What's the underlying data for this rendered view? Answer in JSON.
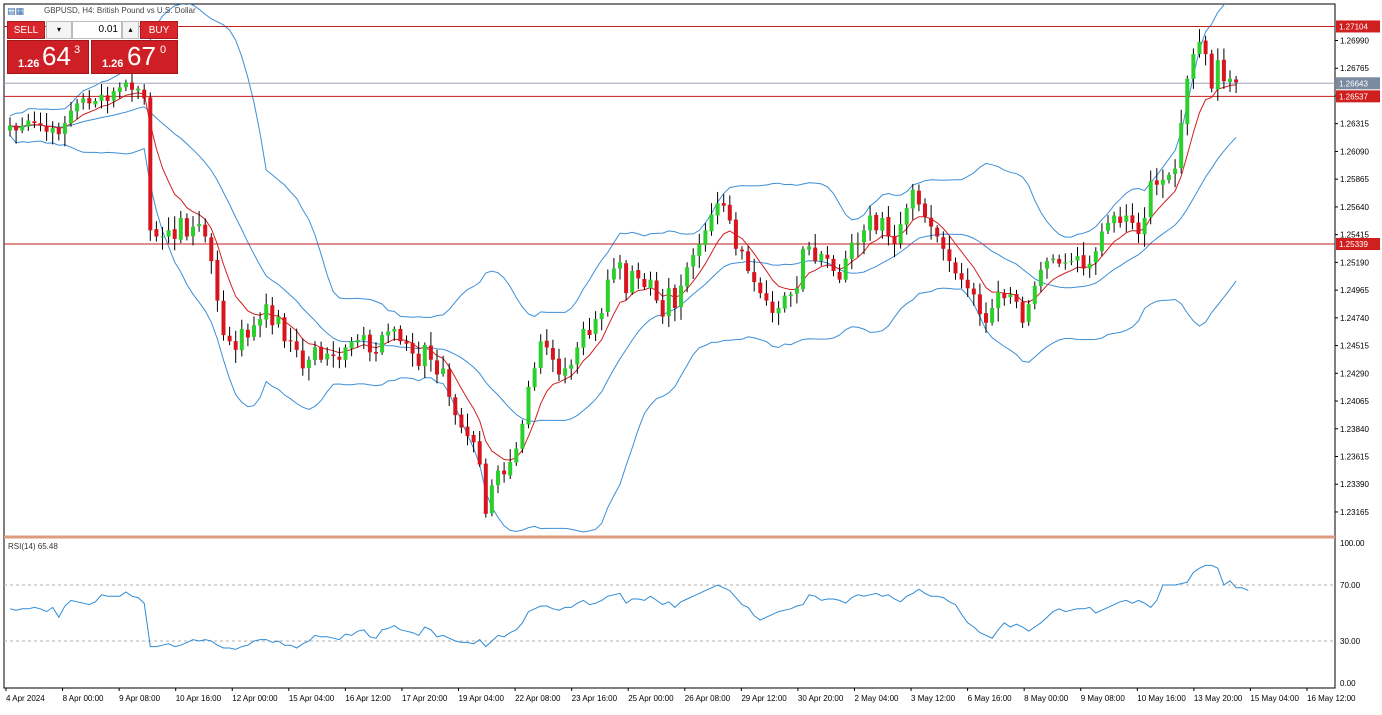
{
  "window": {
    "title": "GBPUSD, H4:  British Pound vs U.S. Dollar",
    "icon": "chart-window-icon"
  },
  "trade_panel": {
    "sell_label": "SELL",
    "buy_label": "BUY",
    "lot": "0.01",
    "bid": {
      "prefix": "1.26",
      "big": "64",
      "small": "3"
    },
    "ask": {
      "prefix": "1.26",
      "big": "67",
      "small": "0"
    },
    "colors": {
      "button": "#d8262c"
    }
  },
  "rsi": {
    "label": "RSI(14) 65.48",
    "levels": [
      "100.00",
      "70.00",
      "30.00",
      "0.00"
    ]
  },
  "price_tags": [
    {
      "value": "1.27104",
      "kind": "line",
      "color": "#d01f1f"
    },
    {
      "value": "1.26643",
      "kind": "current",
      "color": "#7a8aa0"
    },
    {
      "value": "1.26537",
      "kind": "line",
      "color": "#d01f1f"
    },
    {
      "value": "1.25339",
      "kind": "line",
      "color": "#d01f1f"
    }
  ],
  "chart_data": {
    "type": "candlestick",
    "symbol": "GBPUSD",
    "timeframe": "H4",
    "ylim": [
      1.2297,
      1.2727
    ],
    "y_ticks": [
      "1.26990",
      "1.26765",
      "1.26540",
      "1.26315",
      "1.26090",
      "1.25865",
      "1.25640",
      "1.25415",
      "1.25190",
      "1.24965",
      "1.24740",
      "1.24515",
      "1.24290",
      "1.24065",
      "1.23840",
      "1.23615",
      "1.23390",
      "1.23165"
    ],
    "x_labels": [
      "4 Apr 2024",
      "8 Apr 00:00",
      "9 Apr 08:00",
      "10 Apr 16:00",
      "12 Apr 00:00",
      "15 Apr 04:00",
      "16 Apr 12:00",
      "17 Apr 20:00",
      "19 Apr 04:00",
      "22 Apr 08:00",
      "23 Apr 16:00",
      "25 Apr 00:00",
      "26 Apr 08:00",
      "29 Apr 12:00",
      "30 Apr 20:00",
      "2 May 04:00",
      "3 May 12:00",
      "6 May 16:00",
      "8 May 00:00",
      "9 May 08:00",
      "10 May 16:00",
      "13 May 20:00",
      "15 May 04:00",
      "16 May 12:00"
    ],
    "horizontal_lines": [
      1.27104,
      1.26537,
      1.25339
    ],
    "close": [
      1.263,
      1.2626,
      1.263,
      1.2634,
      1.2632,
      1.263,
      1.2625,
      1.2628,
      1.2623,
      1.2632,
      1.2642,
      1.2648,
      1.2652,
      1.2648,
      1.265,
      1.2655,
      1.265,
      1.2658,
      1.2661,
      1.2665,
      1.2659,
      1.266,
      1.2652,
      1.2545,
      1.254,
      1.254,
      1.2545,
      1.2538,
      1.2555,
      1.254,
      1.2548,
      1.255,
      1.254,
      1.252,
      1.2488,
      1.246,
      1.2455,
      1.2448,
      1.2465,
      1.2458,
      1.2468,
      1.2473,
      1.2485,
      1.2468,
      1.2475,
      1.2455,
      1.2455,
      1.2448,
      1.2433,
      1.244,
      1.245,
      1.244,
      1.2445,
      1.2443,
      1.244,
      1.245,
      1.2455,
      1.2456,
      1.246,
      1.2446,
      1.2445,
      1.246,
      1.2463,
      1.2465,
      1.2455,
      1.2453,
      1.2445,
      1.2435,
      1.2452,
      1.244,
      1.2428,
      1.2433,
      1.241,
      1.2395,
      1.2385,
      1.2378,
      1.2373,
      1.2355,
      1.2315,
      1.2338,
      1.235,
      1.2347,
      1.2357,
      1.2368,
      1.2388,
      1.2418,
      1.2433,
      1.2455,
      1.245,
      1.244,
      1.2428,
      1.2433,
      1.2436,
      1.245,
      1.2465,
      1.246,
      1.2473,
      1.2478,
      1.2505,
      1.2514,
      1.2519,
      1.2494,
      1.2512,
      1.2506,
      1.2499,
      1.2505,
      1.2488,
      1.2475,
      1.2498,
      1.2482,
      1.25,
      1.2515,
      1.2525,
      1.2534,
      1.2545,
      1.2558,
      1.2567,
      1.2565,
      1.2553,
      1.253,
      1.2528,
      1.2512,
      1.2503,
      1.2494,
      1.2488,
      1.2478,
      1.2482,
      1.2492,
      1.2493,
      1.2498,
      1.253,
      1.2532,
      1.252,
      1.2526,
      1.2522,
      1.2512,
      1.2505,
      1.2522,
      1.2535,
      1.2535,
      1.2545,
      1.2557,
      1.2545,
      1.2555,
      1.254,
      1.2534,
      1.255,
      1.2563,
      1.2578,
      1.2566,
      1.2556,
      1.2548,
      1.254,
      1.253,
      1.252,
      1.251,
      1.2505,
      1.2498,
      1.2493,
      1.2477,
      1.247,
      1.2482,
      1.2495,
      1.249,
      1.2493,
      1.2487,
      1.247,
      1.2485,
      1.25,
      1.2513,
      1.252,
      1.2522,
      1.2518,
      1.2519,
      1.252,
      1.2524,
      1.2514,
      1.2518,
      1.2528,
      1.2544,
      1.2551,
      1.2557,
      1.2551,
      1.2557,
      1.2551,
      1.2542,
      1.2555,
      1.2585,
      1.2582,
      1.2586,
      1.259,
      1.2595,
      1.2632,
      1.2668,
      1.2688,
      1.2698,
      1.2688,
      1.266,
      1.2683,
      1.2666,
      1.2668,
      1.2665
    ],
    "rsi": [
      53,
      52,
      53,
      53,
      54,
      53,
      51,
      54,
      47,
      55,
      59,
      58,
      57,
      56,
      58,
      63,
      62,
      62,
      62,
      65,
      62,
      61,
      57,
      26,
      26,
      27,
      28,
      26,
      27,
      29,
      31,
      30,
      31,
      30,
      27,
      25,
      25,
      24,
      26,
      27,
      30,
      31,
      31,
      29,
      30,
      27,
      27,
      25,
      28,
      30,
      34,
      33,
      33,
      32,
      31,
      35,
      34,
      37,
      38,
      33,
      32,
      38,
      39,
      41,
      38,
      37,
      36,
      34,
      40,
      38,
      33,
      34,
      32,
      30,
      29,
      29,
      28,
      31,
      26,
      30,
      34,
      33,
      36,
      38,
      43,
      51,
      53,
      55,
      55,
      53,
      52,
      54,
      54,
      57,
      59,
      56,
      57,
      59,
      62,
      63,
      64,
      57,
      60,
      60,
      59,
      62,
      59,
      56,
      58,
      54,
      58,
      60,
      62,
      64,
      66,
      68,
      70,
      68,
      66,
      61,
      56,
      54,
      48,
      45,
      47,
      49,
      51,
      52,
      53,
      55,
      56,
      63,
      62,
      59,
      60,
      60,
      59,
      57,
      61,
      63,
      62,
      63,
      64,
      62,
      63,
      60,
      58,
      62,
      64,
      67,
      64,
      62,
      62,
      61,
      58,
      56,
      49,
      43,
      40,
      36,
      34,
      32,
      38,
      43,
      40,
      42,
      40,
      37,
      40,
      43,
      47,
      51,
      53,
      51,
      52,
      53,
      53,
      54,
      50,
      52,
      54,
      56,
      58,
      59,
      57,
      59,
      57,
      54,
      59,
      70,
      70,
      70,
      71,
      72,
      79,
      82,
      84,
      84,
      82,
      70,
      73,
      68,
      68,
      66
    ]
  }
}
